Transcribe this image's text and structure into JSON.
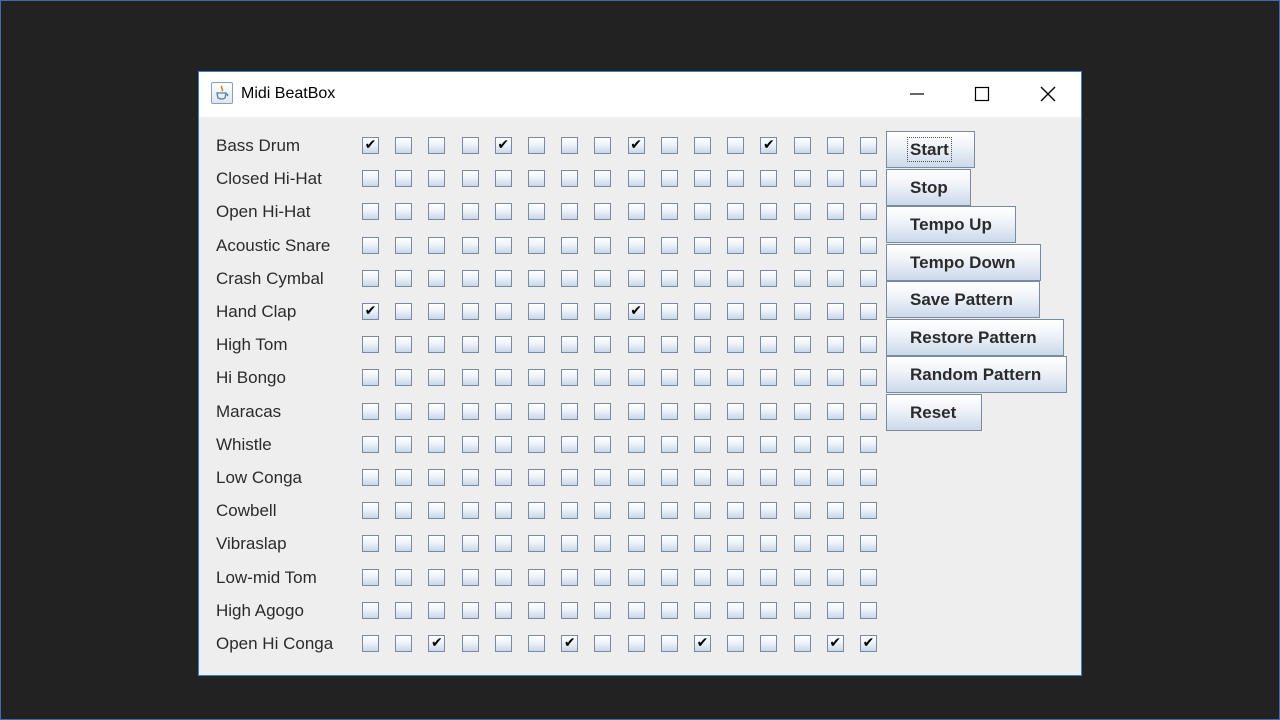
{
  "window": {
    "title": "Midi BeatBox",
    "icon": "java-coffee-cup-icon",
    "controls": [
      "minimize-icon",
      "maximize-icon",
      "close-icon"
    ]
  },
  "instruments": [
    {
      "label": "Bass Drum",
      "checked": [
        0,
        4,
        8,
        12
      ]
    },
    {
      "label": "Closed Hi-Hat",
      "checked": []
    },
    {
      "label": "Open Hi-Hat",
      "checked": []
    },
    {
      "label": "Acoustic Snare",
      "checked": []
    },
    {
      "label": "Crash Cymbal",
      "checked": []
    },
    {
      "label": "Hand Clap",
      "checked": [
        0,
        8
      ]
    },
    {
      "label": "High Tom",
      "checked": []
    },
    {
      "label": "Hi Bongo",
      "checked": []
    },
    {
      "label": "Maracas",
      "checked": []
    },
    {
      "label": "Whistle",
      "checked": []
    },
    {
      "label": "Low Conga",
      "checked": []
    },
    {
      "label": "Cowbell",
      "checked": []
    },
    {
      "label": "Vibraslap",
      "checked": []
    },
    {
      "label": "Low-mid Tom",
      "checked": []
    },
    {
      "label": "High Agogo",
      "checked": []
    },
    {
      "label": "Open Hi Conga",
      "checked": [
        2,
        6,
        10,
        14,
        15
      ]
    }
  ],
  "beats_per_row": 16,
  "check_mark": "✔",
  "buttons": [
    {
      "label": "Start",
      "focused": true
    },
    {
      "label": "Stop",
      "focused": false
    },
    {
      "label": "Tempo Up",
      "focused": false
    },
    {
      "label": "Tempo Down",
      "focused": false
    },
    {
      "label": "Save Pattern",
      "focused": false
    },
    {
      "label": "Restore Pattern",
      "focused": false
    },
    {
      "label": "Random Pattern",
      "focused": false
    },
    {
      "label": "Reset",
      "focused": false
    }
  ],
  "colors": {
    "desktop": "#222222",
    "window_border": "#3b7fd4",
    "panel": "#eeeeee"
  }
}
